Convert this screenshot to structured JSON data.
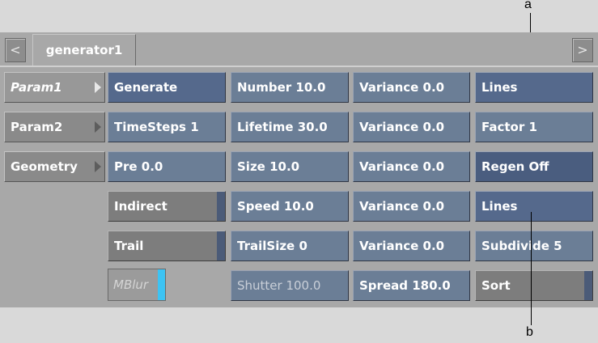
{
  "annotations": {
    "a": "a",
    "b": "b"
  },
  "tabs": {
    "prev": "<",
    "next": ">",
    "active": "generator1"
  },
  "sidebar": [
    {
      "label": "Param1",
      "active": true
    },
    {
      "label": "Param2",
      "active": false
    },
    {
      "label": "Geometry",
      "active": false
    }
  ],
  "col1": {
    "generate": "Generate",
    "timesteps": "TimeSteps 1",
    "pre": "Pre 0.0",
    "indirect": "Indirect",
    "trail": "Trail",
    "mblur": "MBlur"
  },
  "col2": {
    "number": "Number 10.0",
    "lifetime": "Lifetime 30.0",
    "size": "Size 10.0",
    "speed": "Speed 10.0",
    "trailsize": "TrailSize 0",
    "shutter": "Shutter 100.0"
  },
  "col3": {
    "v1": "Variance 0.0",
    "v2": "Variance 0.0",
    "v3": "Variance 0.0",
    "v4": "Variance 0.0",
    "v5": "Variance 0.0",
    "spread": "Spread 180.0"
  },
  "col4": {
    "lines1": "Lines",
    "factor": "Factor 1",
    "regen": "Regen Off",
    "lines2": "Lines",
    "subdivide": "Subdivide 5",
    "sort": "Sort"
  }
}
